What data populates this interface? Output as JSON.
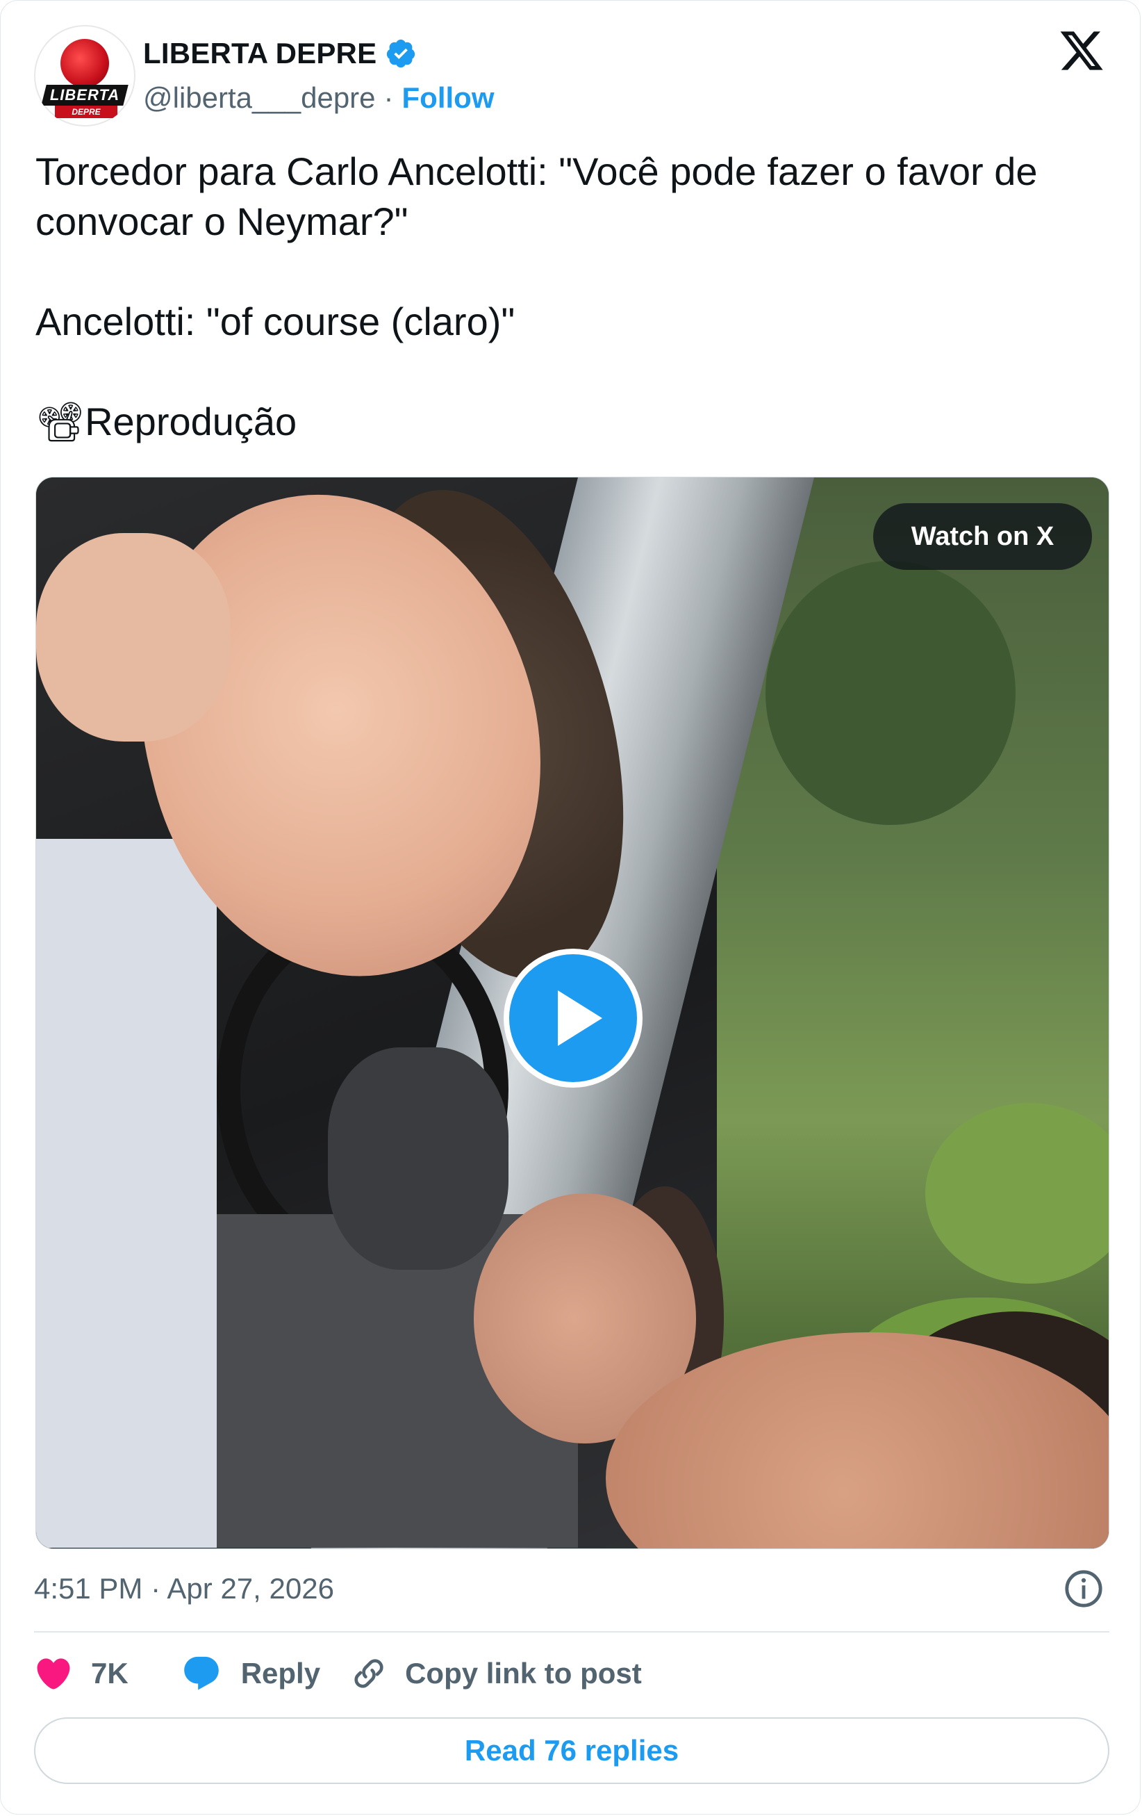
{
  "author": {
    "display_name": "LIBERTA DEPRE",
    "handle": "@liberta___depre",
    "separator": "·",
    "follow_label": "Follow",
    "avatar_text": "LIBERTA",
    "avatar_subtext": "DEPRE",
    "verified": true
  },
  "tweet": {
    "line1": "Torcedor para Carlo Ancelotti: \"Você pode fazer o favor de convocar o Neymar?\"",
    "line2": "Ancelotti: \"of course (claro)\"",
    "line3": "📽Reprodução"
  },
  "media": {
    "watch_label": "Watch on X"
  },
  "meta": {
    "timestamp": "4:51 PM · Apr 27, 2026"
  },
  "actions": {
    "likes": "7K",
    "reply_label": "Reply",
    "copy_label": "Copy link to post"
  },
  "read_replies_label": "Read 76 replies",
  "colors": {
    "accent": "#1d9bf0",
    "like": "#f91880",
    "muted": "#536471",
    "text": "#0f1419"
  },
  "icons": [
    "verified-badge-icon",
    "x-logo-icon",
    "play-icon",
    "info-icon",
    "heart-icon",
    "reply-bubble-icon",
    "link-icon"
  ]
}
